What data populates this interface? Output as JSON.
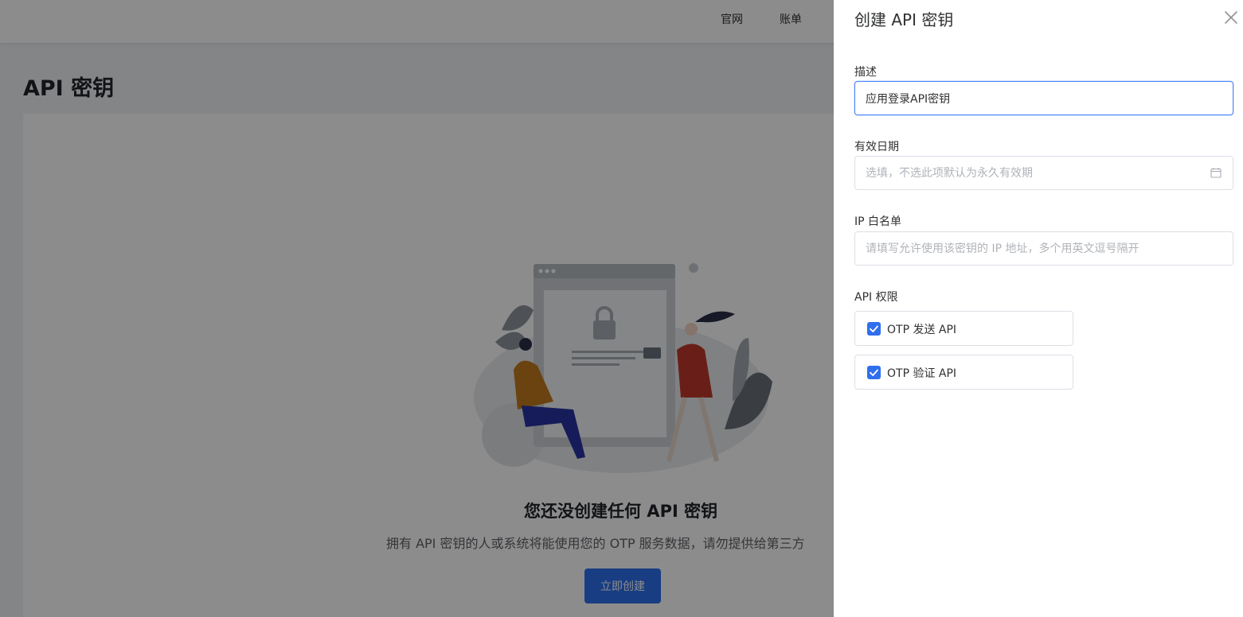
{
  "nav": {
    "home": "官网",
    "bill": "账单"
  },
  "page": {
    "title": "API 密钥"
  },
  "empty": {
    "title": "您还没创建任何 API 密钥",
    "description": "拥有 API 密钥的人或系统将能使用您的 OTP 服务数据，请勿提供给第三方",
    "create_button": "立即创建"
  },
  "drawer": {
    "title": "创建 API 密钥",
    "description_label": "描述",
    "description_value": "应用登录API密钥",
    "expiry_label": "有效日期",
    "expiry_placeholder": "选填，不选此项默认为永久有效期",
    "ip_label": "IP 白名单",
    "ip_placeholder": "请填写允许使用该密钥的 IP 地址，多个用英文逗号隔开",
    "permissions_label": "API 权限",
    "permissions": [
      {
        "label": "OTP 发送 API",
        "checked": true
      },
      {
        "label": "OTP 验证 API",
        "checked": true
      }
    ]
  },
  "colors": {
    "primary": "#2f6fed",
    "overlay": "rgba(0,0,0,0.45)"
  }
}
